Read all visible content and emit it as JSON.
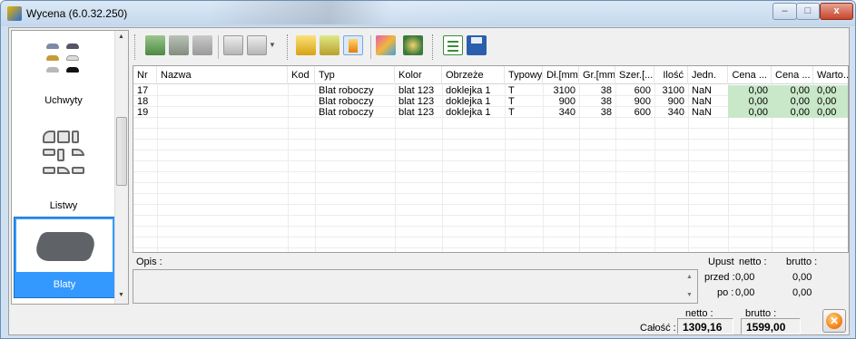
{
  "window": {
    "title": "Wycena (6.0.32.250)",
    "controls": {
      "minimize": "–",
      "maximize": "□",
      "close": "x"
    }
  },
  "palette": {
    "categories": [
      {
        "label": "Uchwyty",
        "icon": "handles-icon"
      },
      {
        "label": "Listwy",
        "icon": "profiles-icon"
      },
      {
        "label": "Blaty",
        "icon": "countertop-icon",
        "selected": true
      }
    ]
  },
  "toolbar": {
    "buttons": [
      "add-row-icon",
      "edit-row-icon",
      "delete-row-icon",
      "print-icon",
      "print-menu-icon",
      "import-icon",
      "sort-ascending-icon",
      "sort-descending-icon",
      "colors-icon",
      "settings-icon",
      "checklist-icon",
      "save-icon"
    ]
  },
  "grid": {
    "columns": [
      "Nr",
      "Nazwa",
      "Kod",
      "Typ",
      "Kolor",
      "Obrzeże",
      "Typowy",
      "Dł.[mm]",
      "Gr.[mm]",
      "Szer.[...",
      "Ilość",
      "Jedn.",
      "Cena ...",
      "Cena ...",
      "Warto..."
    ],
    "rows": [
      [
        "17",
        "",
        "",
        "Blat roboczy",
        "blat 123",
        "doklejka 1",
        "T",
        "3100",
        "38",
        "600",
        "3100",
        "NaN",
        "0,00",
        "0,00",
        "0,00"
      ],
      [
        "18",
        "",
        "",
        "Blat roboczy",
        "blat 123",
        "doklejka 1",
        "T",
        "900",
        "38",
        "900",
        "900",
        "NaN",
        "0,00",
        "0,00",
        "0,00"
      ],
      [
        "19",
        "",
        "",
        "Blat roboczy",
        "blat 123",
        "doklejka 1",
        "T",
        "340",
        "38",
        "600",
        "340",
        "NaN",
        "0,00",
        "0,00",
        "0,00"
      ]
    ],
    "highlight_color": "#c9e8c9"
  },
  "opis": {
    "label": "Opis :",
    "value": ""
  },
  "discount": {
    "upust_label": "Upust",
    "netto_label": "netto :",
    "brutto_label": "brutto :",
    "przed_label": "przed :",
    "przed_netto": "0,00",
    "przed_brutto": "0,00",
    "po_label": "po :",
    "po_netto": "0,00",
    "po_brutto": "0,00"
  },
  "totals": {
    "label": "Całość :",
    "netto_label": "netto :",
    "brutto_label": "brutto :",
    "netto": "1309,16",
    "brutto": "1599,00"
  }
}
